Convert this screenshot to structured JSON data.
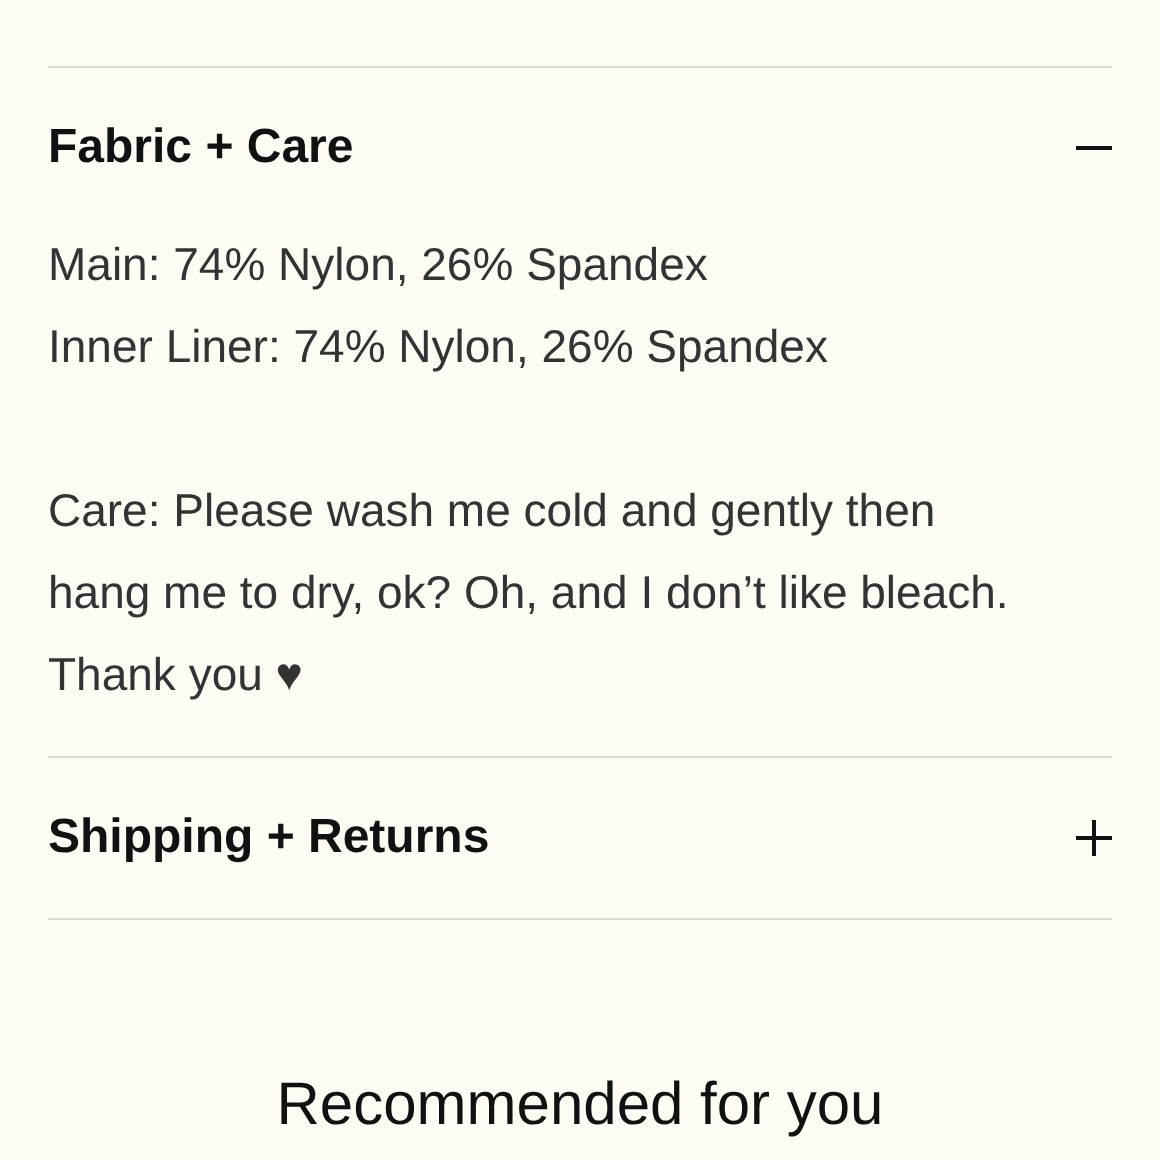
{
  "sections": [
    {
      "title": "Fabric + Care",
      "expanded": true,
      "body": [
        {
          "lines": [
            "Main: 74% Nylon, 26% Spandex",
            "Inner Liner: 74% Nylon, 26% Spandex"
          ]
        },
        {
          "lines": [
            "Care: Please wash me cold and gently then",
            "hang me to dry, ok? Oh, and I don’t like bleach.",
            "Thank you ♥"
          ]
        }
      ]
    },
    {
      "title": "Shipping + Returns",
      "expanded": false
    }
  ],
  "recommended_heading": "Recommended for you"
}
